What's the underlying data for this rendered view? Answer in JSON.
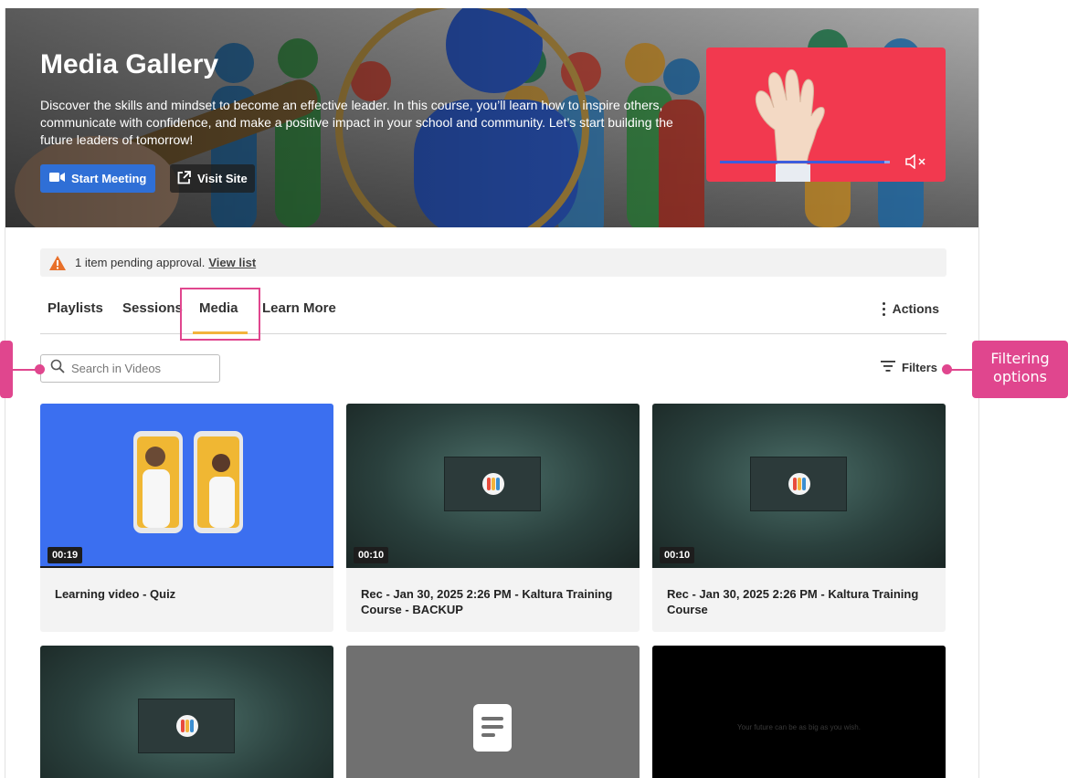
{
  "hero": {
    "title": "Media Gallery",
    "description": "Discover the skills and mindset to become an effective leader. In this course, you’ll learn how to inspire others, communicate with confidence, and make a positive impact in your school and community. Let’s start building the future leaders of tomorrow!",
    "start_meeting_label": "Start Meeting",
    "visit_site_label": "Visit Site",
    "player_progress": 0.97
  },
  "alert": {
    "text": "1 item pending approval.",
    "link_label": "View list"
  },
  "tabs": {
    "items": [
      "Playlists",
      "Sessions",
      "Media",
      "Learn More"
    ],
    "active": "Media",
    "actions_label": "Actions"
  },
  "search": {
    "placeholder": "Search in Videos",
    "value": ""
  },
  "filters_label": "Filters",
  "cards": [
    {
      "title": "Learning video - Quiz",
      "duration": "00:19",
      "thumb": "phones"
    },
    {
      "title": "Rec - Jan 30, 2025 2:26 PM - Kaltura Training Course - BACKUP",
      "duration": "00:10",
      "thumb": "slide"
    },
    {
      "title": "Rec - Jan 30, 2025 2:26 PM - Kaltura Training Course",
      "duration": "00:10",
      "thumb": "slide"
    },
    {
      "title": "",
      "duration": "",
      "thumb": "slide"
    },
    {
      "title": "",
      "duration": "",
      "thumb": "document"
    },
    {
      "title": "",
      "duration": "",
      "thumb": "black",
      "thumb_text": "Your future can be as big as you wish."
    }
  ],
  "callouts": {
    "filters": "Filtering\noptions"
  },
  "colors": {
    "accent": "#e0468e",
    "primary_button": "#2f6fd6",
    "tab_underline": "#f3b33c",
    "player_bg": "#f2394f"
  }
}
